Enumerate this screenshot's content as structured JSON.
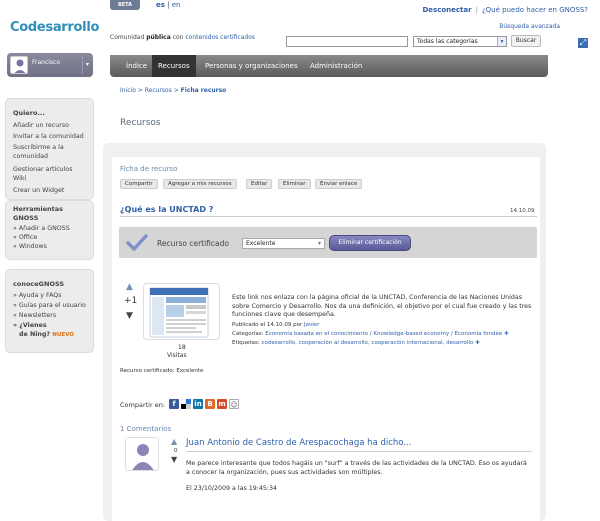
{
  "header": {
    "beta": "BETA",
    "lang_es": "es",
    "lang_sep": " | ",
    "lang_en": "en",
    "logout": "Desconectar",
    "help": "¿Qué puedo hacer en GNOSS?",
    "advanced_search": "Búsqueda avanzada",
    "logo": "Codesarrollo",
    "tagline_prefix": "Comunidad ",
    "tagline_bold": "pública",
    "tagline_mid": " con ",
    "tagline_link": "contenidos certificados",
    "category_value": "Todas las categorías",
    "search_button": "Buscar"
  },
  "nav": {
    "items": [
      "Índice",
      "Recursos",
      "Personas y organizaciones",
      "Administración"
    ]
  },
  "user": {
    "name": "Francisco"
  },
  "sidebar": {
    "quiero": {
      "title": "Quiero...",
      "items": [
        "Añadir un recurso",
        "Invitar a la comunidad",
        "Suscribirme a la",
        "comunidad",
        "Gestionar artículos",
        "Wiki",
        "Crear un Widget"
      ]
    },
    "tools": {
      "title": "Herramientas",
      "title2": "GNOSS",
      "items": [
        "» Añadir a GNOSS",
        "» Office",
        "» Windows"
      ]
    },
    "conoce": {
      "title": "conoceGNOSS",
      "items": [
        "» Ayuda y FAQs",
        "» Guías para el usuario",
        "» Newsletters",
        "» ¿Vienes",
        "de Ning?"
      ],
      "new_badge": "NUEVO"
    }
  },
  "breadcrumb": {
    "home": "Inicio",
    "sep": " > ",
    "section": "Recursos",
    "current": "Ficha recurso"
  },
  "page_title": "Recursos",
  "resource": {
    "ficha_label": "Ficha de recurso",
    "actions": [
      "Compartir",
      "Agregar a mis recursos",
      "Editar",
      "Eliminar",
      "Enviar enlace"
    ],
    "title": "¿Qué es la UNCTAD ?",
    "date": "14.10.09",
    "cert_label": "Recurso certificado",
    "cert_value": "Excelente",
    "cert_remove": "Eliminar certificación",
    "votes": "+1",
    "visits_count": "18",
    "visits_label": "Visitas",
    "cert_text": "Recurso certificado: Excelente",
    "description": "Este link nos enlaza con la página oficial de la UNCTAD, Conferencia de las Naciones Unidas sobre Comercio y Desarrollo. Nos da una definición, el objetivo por el cual fue creado y las tres funciones clave que desempeña.",
    "published_prefix": "Publicado el 14.10.09 por ",
    "published_author": "Javier",
    "categories_label": "Categorías: ",
    "categories": "Economía basada en el conocimiento / Knowledge-based economy / Economía fondée",
    "tags_label": "Etiquetas: ",
    "tags": "codesarrollo, cooperación al desarrollo, cooperación internacional, desarrollo",
    "share_label": "Compartir en:"
  },
  "comments": {
    "header": "1 Comentarios",
    "items": [
      {
        "votes": "0",
        "author": "Juan Antonio de Castro de Arespacochaga ha dicho...",
        "text": "Me parece interesante que todos hagáis un \"surf\" a través de las actividades de la UNCTAD. Eso os ayudará a conocer la organización, pues sus actividades son múltiples.",
        "date": "El 23/10/2009 a las 19:45:34"
      }
    ]
  },
  "colors": {
    "link": "#2f5fa8",
    "nav_bg": "#6a6a6a",
    "cert_button": "#6a6aa8",
    "nuevo": "#e07010"
  }
}
